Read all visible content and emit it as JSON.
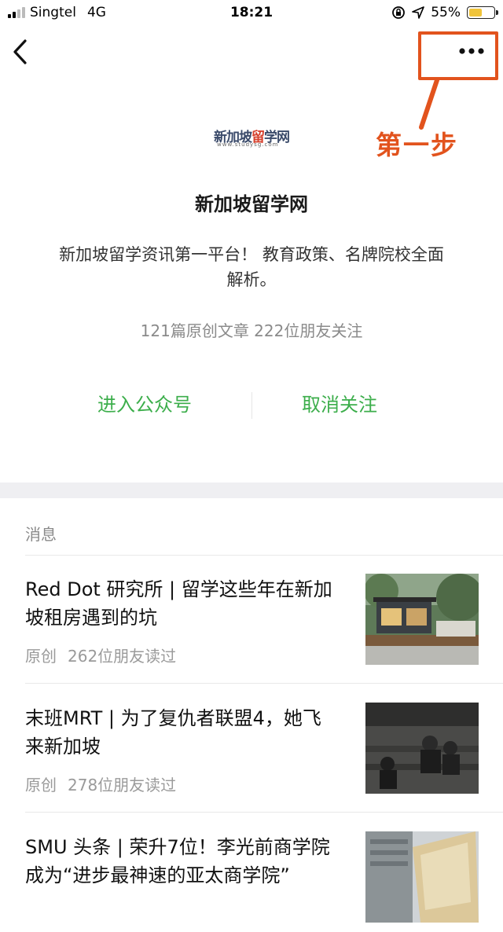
{
  "status_bar": {
    "carrier": "Singtel",
    "network": "4G",
    "time": "18:21",
    "battery": "55%",
    "battery_level": 0.55
  },
  "nav": {
    "back_icon": "chevron-left-icon",
    "more_icon": "ellipsis-icon"
  },
  "annotation": {
    "label": "第一步",
    "color": "#e2531d"
  },
  "account": {
    "logo_text_a": "新加坡",
    "logo_text_b": "留",
    "logo_text_c": "学网",
    "logo_sub": "www.studysg.com",
    "name": "新加坡留学网",
    "description": "新加坡留学资讯第一平台！ 教育政策、名牌院校全面解析。",
    "stats": "121篇原创文章  222位朋友关注",
    "enter_label": "进入公众号",
    "unfollow_label": "取消关注"
  },
  "messages": {
    "section_title": "消息",
    "articles": [
      {
        "title": "Red Dot 研究所 | 留学这些年在新加坡租房遇到的坑",
        "tag": "原创",
        "reads": "262位朋友读过"
      },
      {
        "title": "末班MRT | 为了复仇者联盟4，她飞来新加坡",
        "tag": "原创",
        "reads": "278位朋友读过"
      },
      {
        "title": "SMU 头条 | 荣升7位！李光前商学院成为“进步最神速的亚太商学院”",
        "tag": "",
        "reads": ""
      }
    ]
  },
  "colors": {
    "accent_green": "#3cae4b",
    "annotation_orange": "#e2531d"
  }
}
